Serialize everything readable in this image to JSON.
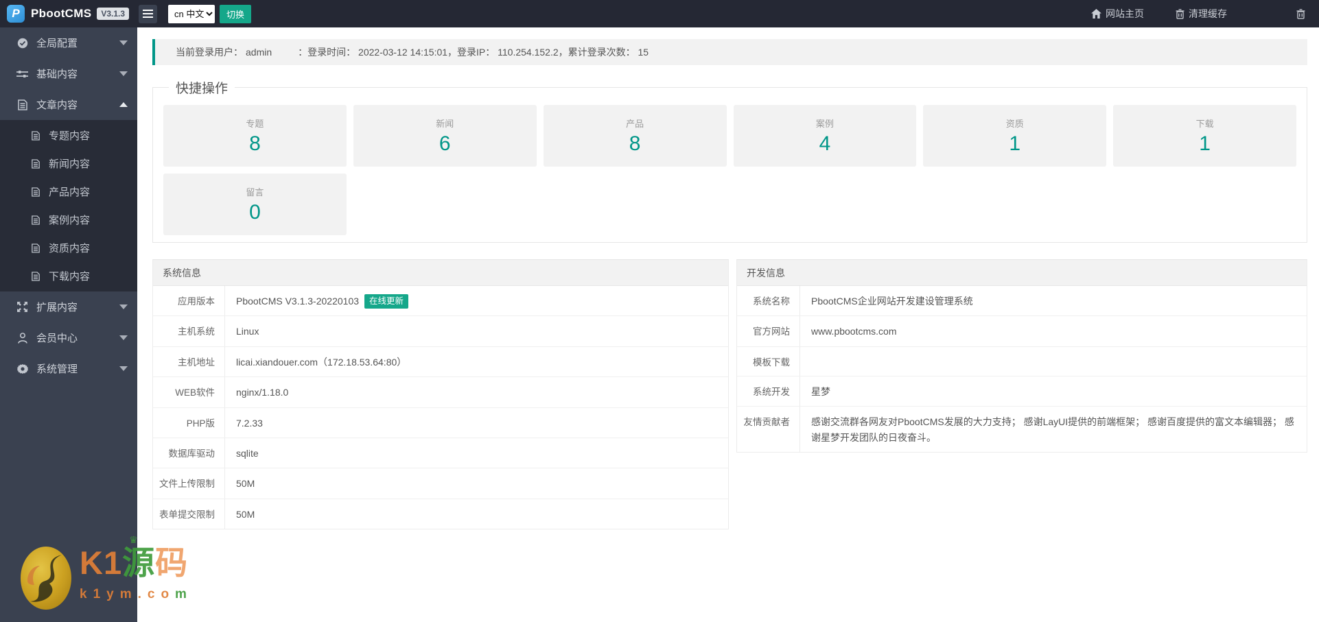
{
  "topbar": {
    "brand": "PbootCMS",
    "version": "V3.1.3",
    "language_selected": "cn 中文",
    "switch_label": "切换",
    "home_label": "网站主页",
    "clear_cache_label": "清理缓存"
  },
  "sidebar": {
    "groups": [
      {
        "label": "全局配置",
        "icon": "globe-icon",
        "expanded": false
      },
      {
        "label": "基础内容",
        "icon": "sliders-icon",
        "expanded": false
      },
      {
        "label": "文章内容",
        "icon": "file-text-icon",
        "expanded": true,
        "children": [
          "专题内容",
          "新闻内容",
          "产品内容",
          "案例内容",
          "资质内容",
          "下载内容"
        ]
      },
      {
        "label": "扩展内容",
        "icon": "expand-icon",
        "expanded": false
      },
      {
        "label": "会员中心",
        "icon": "user-icon",
        "expanded": false
      },
      {
        "label": "系统管理",
        "icon": "gear-icon",
        "expanded": false
      }
    ]
  },
  "login_info": {
    "label": "当前登录用户：",
    "username": "admin",
    "details": "：登录时间： 2022-03-12 14:15:01，登录IP： 110.254.152.2，累计登录次数： 15"
  },
  "quick_actions": {
    "title": "快捷操作",
    "cards": [
      {
        "label": "专题",
        "count": "8"
      },
      {
        "label": "新闻",
        "count": "6"
      },
      {
        "label": "产品",
        "count": "8"
      },
      {
        "label": "案例",
        "count": "4"
      },
      {
        "label": "资质",
        "count": "1"
      },
      {
        "label": "下载",
        "count": "1"
      },
      {
        "label": "留言",
        "count": "0"
      }
    ]
  },
  "system_info": {
    "title": "系统信息",
    "rows": [
      {
        "label": "应用版本",
        "value": "PbootCMS V3.1.3-20220103",
        "badge": "在线更新"
      },
      {
        "label": "主机系统",
        "value": "Linux"
      },
      {
        "label": "主机地址",
        "value": "licai.xiandouer.com（172.18.53.64:80）"
      },
      {
        "label": "WEB软件",
        "value": "nginx/1.18.0"
      },
      {
        "label": "PHP版",
        "value": "7.2.33"
      },
      {
        "label": "数据库驱动",
        "value": "sqlite"
      },
      {
        "label": "文件上传限制",
        "value": "50M"
      },
      {
        "label": "表单提交限制",
        "value": "50M"
      }
    ]
  },
  "dev_info": {
    "title": "开发信息",
    "rows": [
      {
        "label": "系统名称",
        "value": "PbootCMS企业网站开发建设管理系统"
      },
      {
        "label": "官方网站",
        "value": "www.pbootcms.com"
      },
      {
        "label": "模板下载",
        "value": ""
      },
      {
        "label": "系统开发",
        "value": "星梦"
      },
      {
        "label": "友情贡献者",
        "value": "感谢交流群各网友对PbootCMS发展的大力支持； 感谢LayUI提供的前端框架； 感谢百度提供的富文本编辑器； 感谢星梦开发团队的日夜奋斗。"
      }
    ]
  },
  "watermark": {
    "brand_k1": "K1",
    "brand_yuan": "源",
    "brand_ma": "码",
    "domain_part1": "k1ym.co",
    "domain_part2": "m"
  },
  "colors": {
    "accent_teal": "#009688",
    "button_green": "#15a78a",
    "topbar_bg": "#252834",
    "sidebar_bg": "#3a4150",
    "submenu_bg": "#282c37",
    "panel_gray": "#f2f2f2"
  }
}
